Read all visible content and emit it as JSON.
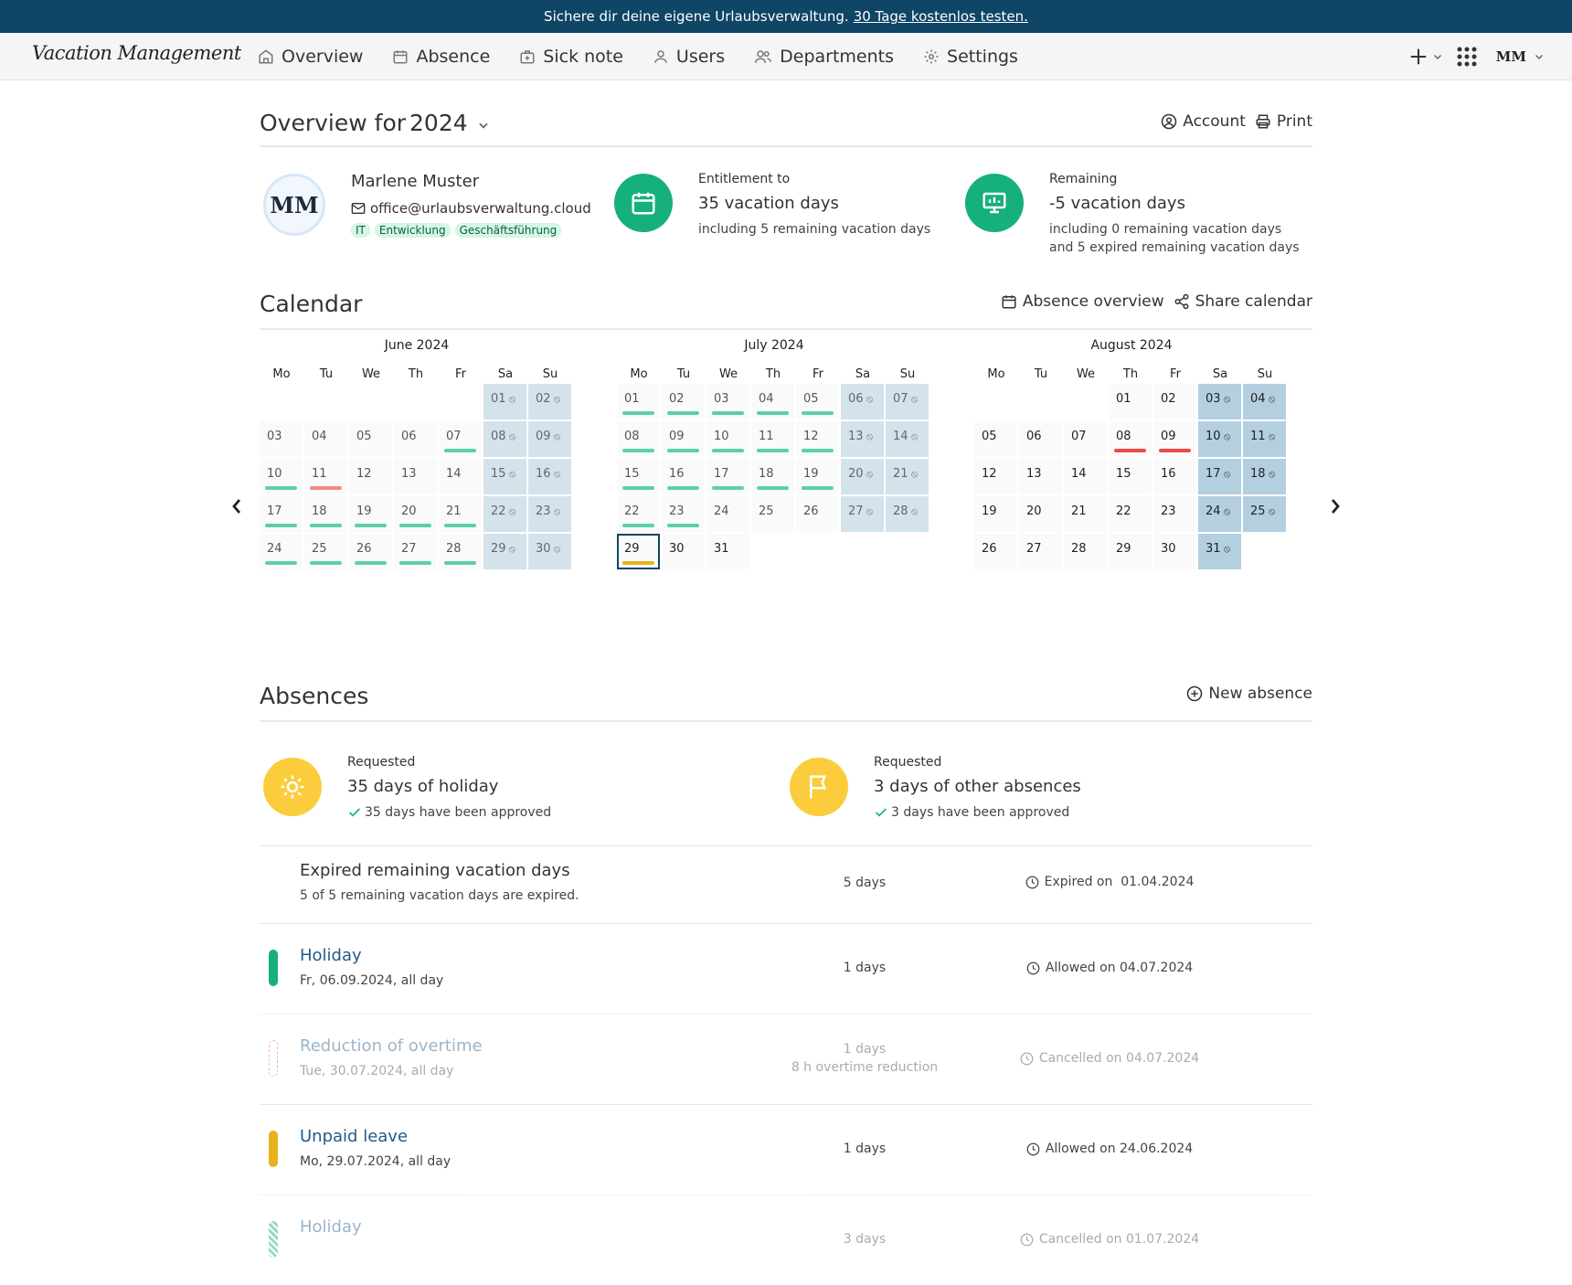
{
  "banner": {
    "text": "Sichere dir deine eigene Urlaubsverwaltung.",
    "link": "30 Tage kostenlos testen."
  },
  "nav": {
    "logo": "Vacation Management",
    "items": [
      {
        "label": "Overview",
        "icon": "home-icon"
      },
      {
        "label": "Absence",
        "icon": "calendar-icon"
      },
      {
        "label": "Sick note",
        "icon": "medkit-icon"
      },
      {
        "label": "Users",
        "icon": "user-icon"
      },
      {
        "label": "Departments",
        "icon": "users-icon"
      },
      {
        "label": "Settings",
        "icon": "gear-icon"
      }
    ],
    "avatar": "MM"
  },
  "overview": {
    "title": "Overview for",
    "year": "2024",
    "account": "Account",
    "print": "Print"
  },
  "person": {
    "initials": "MM",
    "name": "Marlene Muster",
    "email": "office@urlaubsverwaltung.cloud",
    "tags": [
      "IT",
      "Entwicklung",
      "Geschäftsführung"
    ]
  },
  "entitlement": {
    "label": "Entitlement to",
    "value": "35 vacation days",
    "sub": "including 5 remaining vacation days"
  },
  "remaining": {
    "label": "Remaining",
    "value": "-5 vacation days",
    "sub1": "including 0 remaining vacation days",
    "sub2": "and 5 expired remaining vacation days"
  },
  "calendar": {
    "title": "Calendar",
    "absence_overview": "Absence overview",
    "share": "Share calendar",
    "weekdays": [
      "Mo",
      "Tu",
      "We",
      "Th",
      "Fr",
      "Sa",
      "Su"
    ],
    "months": [
      {
        "title": "June 2024",
        "start": 5,
        "days": 30
      },
      {
        "title": "July 2024",
        "start": 0,
        "days": 31
      },
      {
        "title": "August 2024",
        "start": 3,
        "days": 31
      }
    ],
    "today": {
      "month": 1,
      "day": 29
    },
    "past_until": {
      "month": 1,
      "day": 28
    },
    "marks": {
      "0": {
        "7": "hol",
        "10": "hol",
        "11": "sick",
        "17": "hol",
        "18": "hol",
        "19": "hol",
        "20": "hol",
        "21": "hol",
        "24": "hol",
        "25": "hol",
        "26": "hol",
        "27": "hol",
        "28": "hol"
      },
      "1": {
        "1": "hol",
        "2": "hol",
        "3": "hol",
        "4": "hol",
        "5": "hol",
        "8": "hol",
        "9": "hol",
        "10": "hol",
        "11": "hol",
        "12": "hol",
        "15": "hol",
        "16": "hol",
        "17": "hol",
        "18": "hol",
        "19": "hol",
        "22": "hol",
        "23": "hol",
        "29": "unp"
      },
      "2": {
        "8": "sickf",
        "9": "sickf"
      }
    }
  },
  "absences": {
    "title": "Absences",
    "new": "New absence",
    "holiday": {
      "label": "Requested",
      "value": "35 days of holiday",
      "approved": "35 days have been approved"
    },
    "other": {
      "label": "Requested",
      "value": "3 days of other absences",
      "approved": "3 days have been approved"
    },
    "expired": {
      "title": "Expired remaining vacation days",
      "sub": "5 of 5 remaining vacation days are expired.",
      "days": "5 days",
      "date": "Expired on  01.04.2024"
    },
    "rows": [
      {
        "title": "Holiday",
        "sub": "Fr, 06.09.2024, all day",
        "days": "1 days",
        "extra": "",
        "date": "Allowed on 04.07.2024",
        "color": "#15b07b",
        "style": "solid",
        "faded": false
      },
      {
        "title": "Reduction of overtime",
        "sub": "Tue, 30.07.2024, all day",
        "days": "1 days",
        "extra": "8 h overtime reduction",
        "date": "Cancelled on 04.07.2024",
        "color": "#e05a7a",
        "style": "dashed",
        "faded": true
      },
      {
        "title": "Unpaid leave",
        "sub": "Mo, 29.07.2024, all day",
        "days": "1 days",
        "extra": "",
        "date": "Allowed on 24.06.2024",
        "color": "#e8b21c",
        "style": "solid",
        "faded": false
      },
      {
        "title": "Holiday",
        "sub": "",
        "days": "3 days",
        "extra": "",
        "date": "Cancelled on 01.07.2024",
        "color": "#15b07b",
        "style": "wavy",
        "faded": true
      }
    ]
  }
}
